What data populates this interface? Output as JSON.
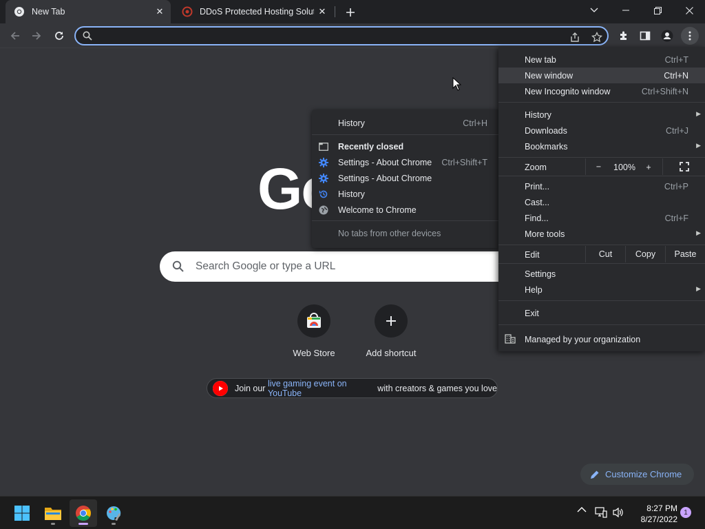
{
  "browser": {
    "tabs": [
      {
        "title": "New Tab",
        "icon": "chrome-icon",
        "active": true
      },
      {
        "title": "DDoS Protected Hosting Solution",
        "icon": "site-favicon",
        "active": false
      }
    ],
    "address_bar": {
      "value": "",
      "placeholder": ""
    }
  },
  "ntp": {
    "logo_text": "Go",
    "search_placeholder": "Search Google or type a URL",
    "shortcuts": [
      {
        "label": "Web Store",
        "icon": "web-store-icon"
      },
      {
        "label": "Add shortcut",
        "icon": "plus-icon"
      }
    ],
    "promo": {
      "prefix": "Join our ",
      "link": "live gaming event on YouTube",
      "suffix": " with creators & games you love"
    },
    "customize_label": "Customize Chrome"
  },
  "history_submenu": {
    "history": {
      "label": "History",
      "shortcut": "Ctrl+H"
    },
    "recently_closed_heading": "Recently closed",
    "items": [
      {
        "label": "Settings - About Chrome",
        "shortcut": "Ctrl+Shift+T",
        "icon": "gear-icon"
      },
      {
        "label": "Settings - About Chrome",
        "shortcut": "",
        "icon": "gear-icon"
      },
      {
        "label": "History",
        "shortcut": "",
        "icon": "history-icon"
      },
      {
        "label": "Welcome to Chrome",
        "shortcut": "",
        "icon": "globe-icon"
      }
    ],
    "no_tabs": "No tabs from other devices"
  },
  "main_menu": {
    "new_tab": {
      "label": "New tab",
      "shortcut": "Ctrl+T"
    },
    "new_window": {
      "label": "New window",
      "shortcut": "Ctrl+N"
    },
    "new_incognito": {
      "label": "New Incognito window",
      "shortcut": "Ctrl+Shift+N"
    },
    "history": {
      "label": "History"
    },
    "downloads": {
      "label": "Downloads",
      "shortcut": "Ctrl+J"
    },
    "bookmarks": {
      "label": "Bookmarks"
    },
    "zoom": {
      "label": "Zoom",
      "minus": "−",
      "level": "100%",
      "plus": "+"
    },
    "print": {
      "label": "Print...",
      "shortcut": "Ctrl+P"
    },
    "cast": {
      "label": "Cast..."
    },
    "find": {
      "label": "Find...",
      "shortcut": "Ctrl+F"
    },
    "more_tools": {
      "label": "More tools"
    },
    "edit": {
      "label": "Edit",
      "cut": "Cut",
      "copy": "Copy",
      "paste": "Paste"
    },
    "settings": {
      "label": "Settings"
    },
    "help": {
      "label": "Help"
    },
    "exit": {
      "label": "Exit"
    },
    "managed": {
      "label": "Managed by your organization"
    }
  },
  "taskbar": {
    "time": "8:27 PM",
    "date": "8/27/2022",
    "notification_count": "1",
    "apps": [
      "start-icon",
      "file-explorer-icon",
      "chrome-icon",
      "paint-icon"
    ]
  },
  "colors": {
    "frame": "#202124",
    "toolbar": "#35363a",
    "menu": "#292a2d",
    "accent": "#8ab4f8",
    "taskbar": "#1c1c1c"
  }
}
